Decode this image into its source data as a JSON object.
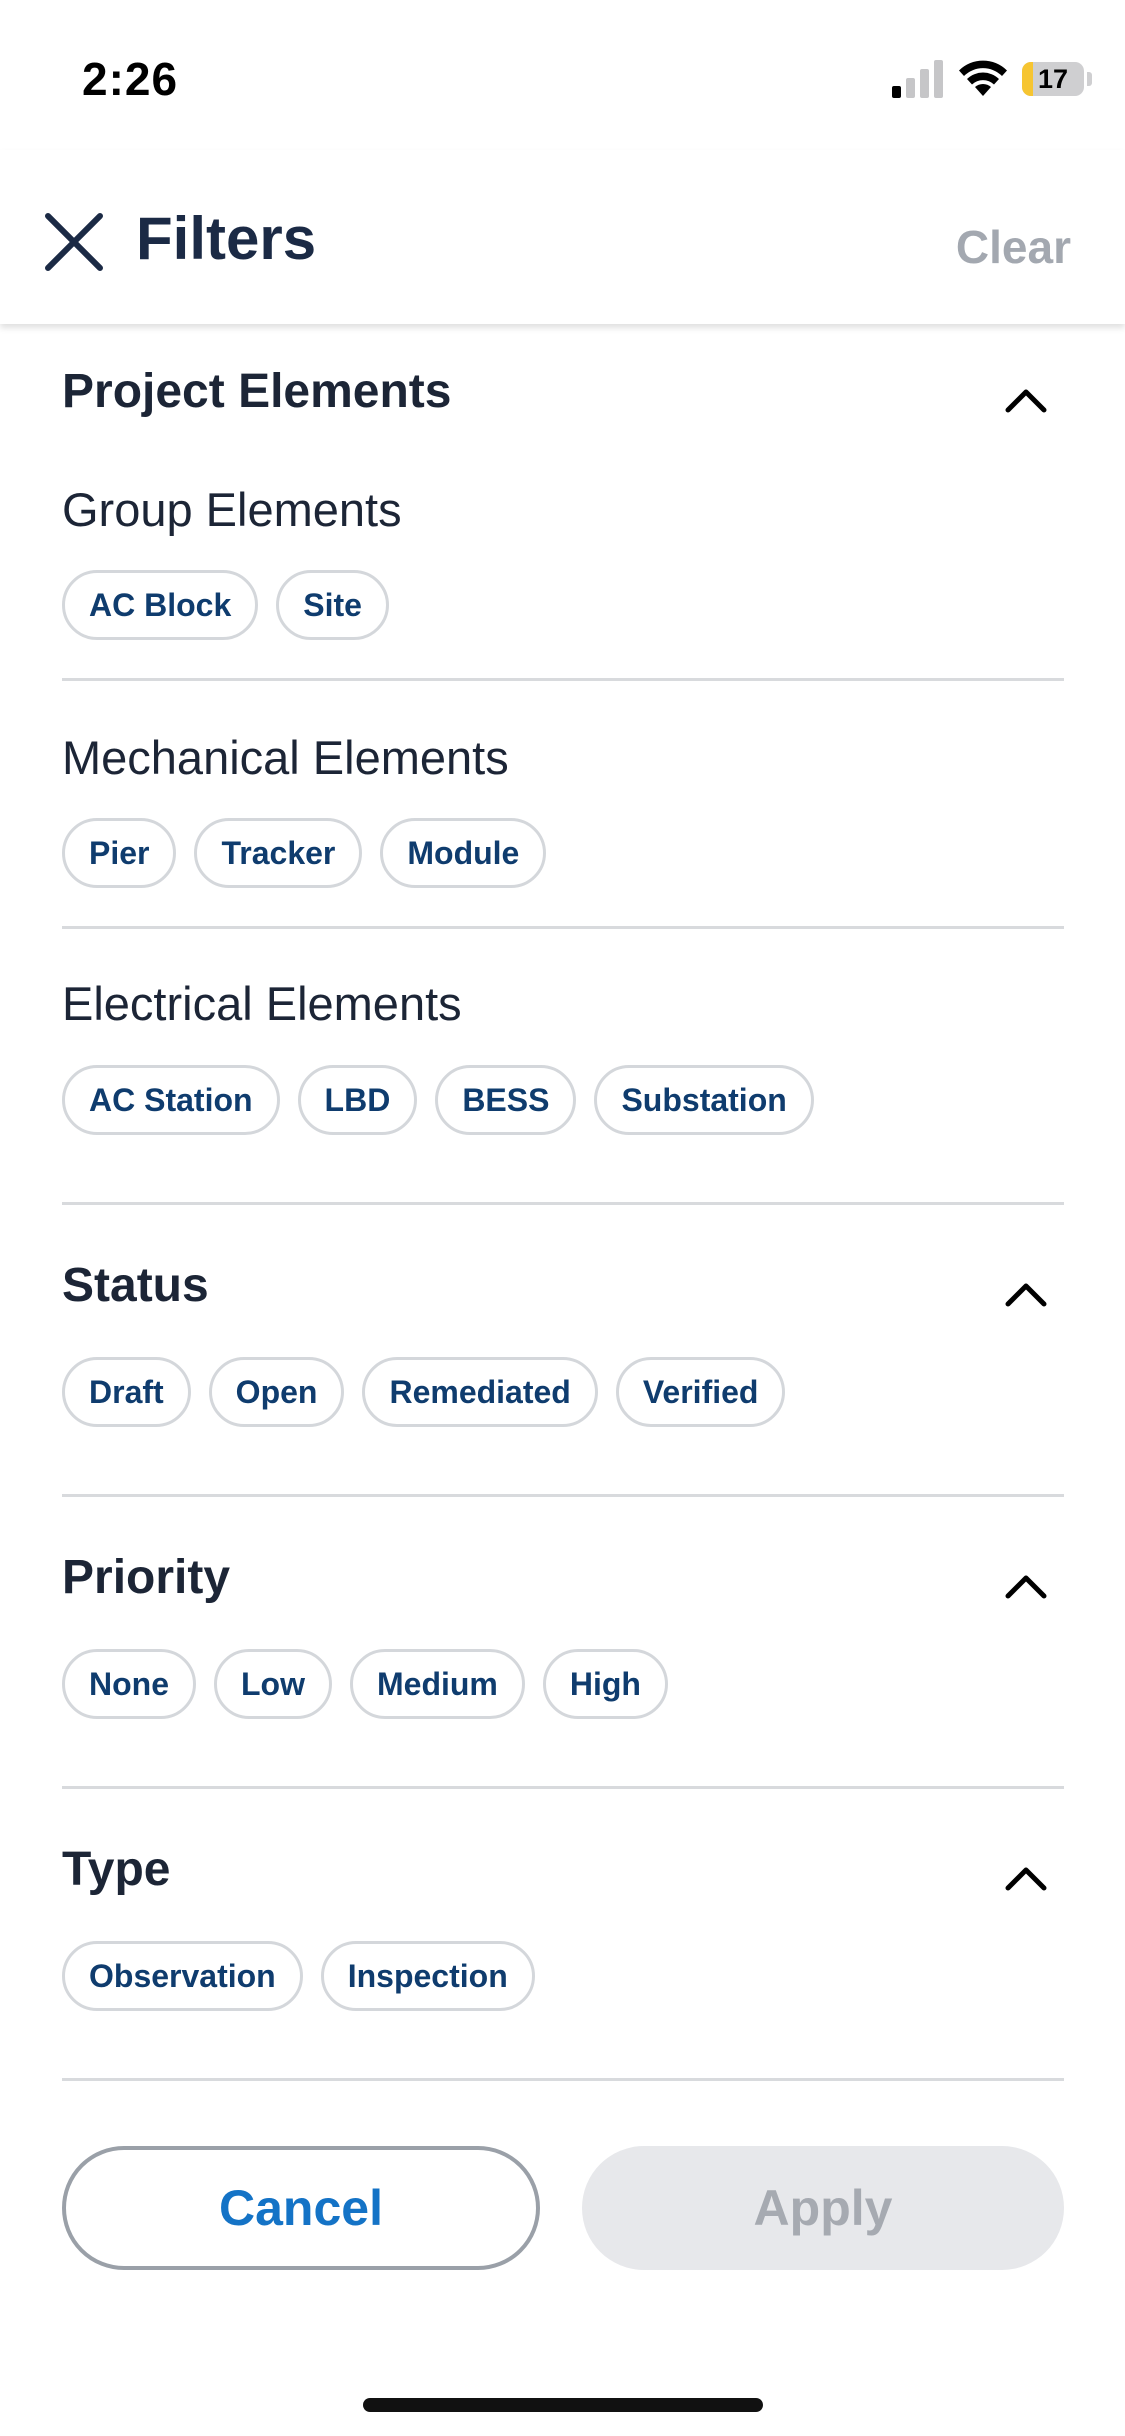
{
  "status_bar": {
    "time": "2:26",
    "battery_level": "17",
    "battery_fraction": 0.17,
    "icons": [
      "signal-icon",
      "wifi-icon",
      "battery-icon"
    ]
  },
  "header": {
    "title": "Filters",
    "clear_label": "Clear",
    "close_icon": "close-icon"
  },
  "sections": {
    "project_elements": {
      "title": "Project Elements",
      "groups": {
        "group": {
          "title": "Group Elements",
          "chips": [
            "AC Block",
            "Site"
          ]
        },
        "mechanical": {
          "title": "Mechanical Elements",
          "chips": [
            "Pier",
            "Tracker",
            "Module"
          ]
        },
        "electrical": {
          "title": "Electrical Elements",
          "chips": [
            "AC Station",
            "LBD",
            "BESS",
            "Substation"
          ]
        }
      }
    },
    "status": {
      "title": "Status",
      "chips": [
        "Draft",
        "Open",
        "Remediated",
        "Verified"
      ]
    },
    "priority": {
      "title": "Priority",
      "chips": [
        "None",
        "Low",
        "Medium",
        "High"
      ]
    },
    "type": {
      "title": "Type",
      "chips": [
        "Observation",
        "Inspection"
      ]
    }
  },
  "footer": {
    "cancel_label": "Cancel",
    "apply_label": "Apply"
  },
  "colors": {
    "chip_text": "#0f3c6e",
    "accent": "#1473c6",
    "disabled": "#a6aab1"
  }
}
